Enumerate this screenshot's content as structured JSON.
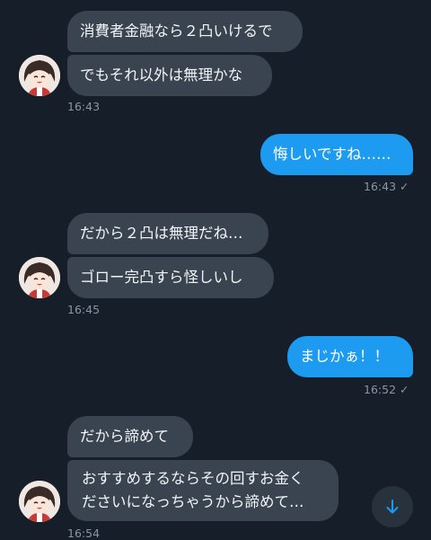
{
  "messages": {
    "g1": {
      "line1": "消費者金融なら２凸いけるで",
      "line2": "でもそれ以外は無理かな",
      "time": "16:43"
    },
    "o1": {
      "text": "悔しいですね……",
      "time": "16:43",
      "check": "✓"
    },
    "g2": {
      "line1": "だから２凸は無理だね…",
      "line2": "ゴロー完凸すら怪しいし",
      "time": "16:45"
    },
    "o2": {
      "text": "まじかぁ！！",
      "time": "16:52",
      "check": "✓"
    },
    "g3": {
      "line1": "だから諦めて",
      "line2a": "おすすめするならその回すお金く",
      "line2b": "ださいになっちゃうから諦めて…",
      "time": "16:54"
    }
  },
  "icons": {
    "avatar": "avatar-icon",
    "scroll": "arrow-down-icon",
    "read": "check-icon"
  },
  "colors": {
    "background": "#151e29",
    "incoming_bubble": "#3a4450",
    "outgoing_bubble": "#1d9bf0",
    "timestamp": "#8a96a3"
  }
}
